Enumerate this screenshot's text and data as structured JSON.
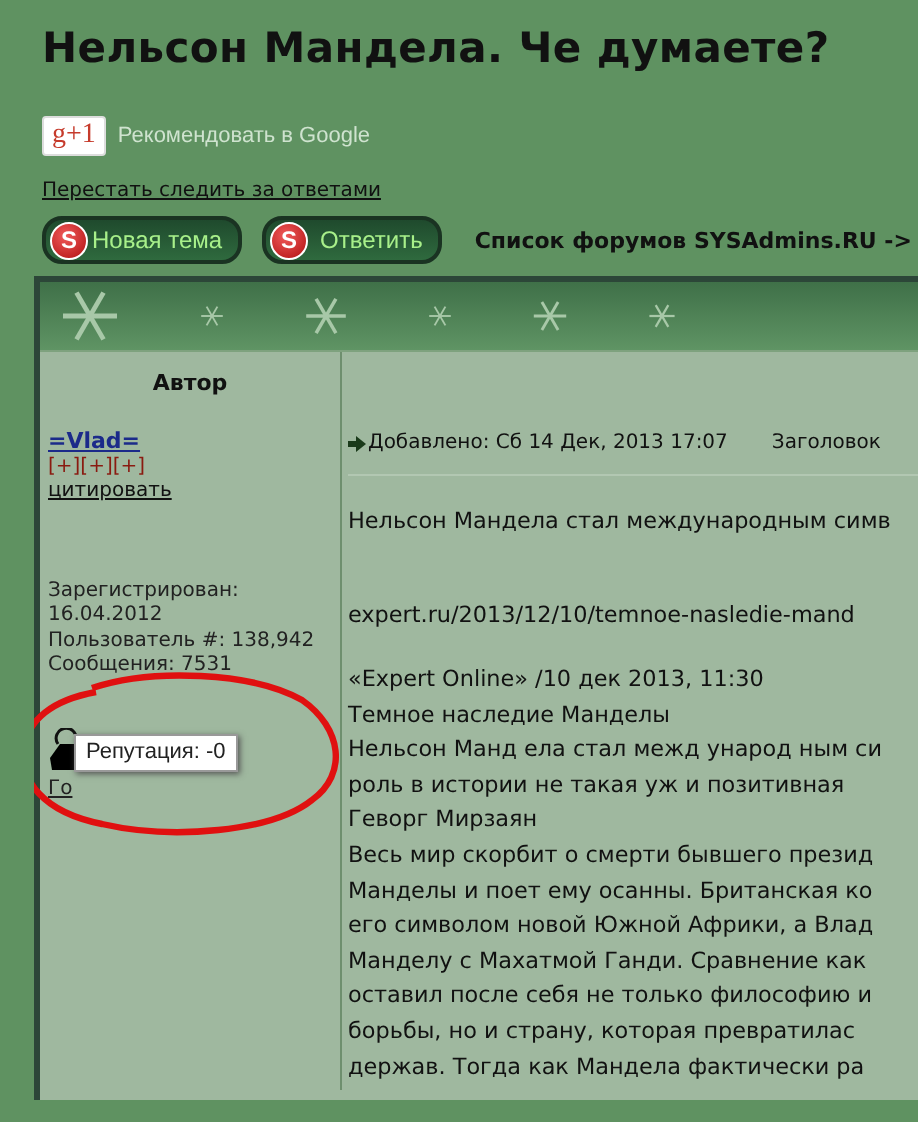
{
  "title": "Нельсон Мандела. Че думаете?",
  "google_plus": {
    "badge": "g+1",
    "label": "Рекомендовать в Google"
  },
  "unwatch_link": "Перестать следить за ответами",
  "buttons": [
    {
      "label": "Новая тема",
      "icon_letter": "S"
    },
    {
      "label": "Ответить",
      "icon_letter": "S"
    }
  ],
  "breadcrumb": "Список форумов SYSAdmins.RU ->",
  "table": {
    "columns": [
      "Автор"
    ],
    "post": {
      "author": {
        "name": "=Vlad=",
        "rank": "[+][+][+]",
        "quote_link": "цитировать",
        "details": [
          "Зарегистрирован:",
          "16.04.2012",
          "Пользователь #: 138,942",
          "Сообщения: 7531"
        ],
        "partial_text": "Го",
        "tooltip": "Репутация: -0"
      },
      "meta": {
        "posted": "Добавлено: Сб 14 Дек, 2013 17:07",
        "subject_label": "Заголовок"
      },
      "intro": "Нельсон Мандела стал международным симв",
      "link": "expert.ru/2013/12/10/temnoe-nasledie-mand",
      "lines": [
        "«Expert Online» /10 дек 2013, 11:30",
        "Темное наследие Манделы",
        "Нельсон Манд ела стал межд ународ ным си",
        "роль в истории не такая уж и позитивная",
        "Геворг Мирзаян",
        "Весь мир скорбит о смерти бывшего презид",
        "Манделы и поет ему осанны. Британская ко",
        "его символом новой Южной Африки, а Влад",
        "Манделу с Махатмой Ганди. Сравнение как",
        "оставил после себя не только философию и",
        "борьбы, но и страну, которая превратилас",
        "держав. Тогда как Мандела фактически ра"
      ]
    }
  }
}
